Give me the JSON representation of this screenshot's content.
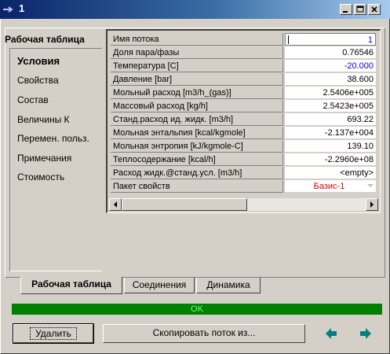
{
  "window": {
    "title": "1",
    "system_icon": "stream-icon",
    "controls": [
      "minimize-icon",
      "maximize-icon",
      "close-icon"
    ]
  },
  "nav": {
    "title": "Рабочая таблица",
    "items": [
      {
        "label": "Условия",
        "active": true
      },
      {
        "label": "Свойства",
        "active": false
      },
      {
        "label": "Состав",
        "active": false
      },
      {
        "label": "Величины К",
        "active": false
      },
      {
        "label": "Перемен. польз.",
        "active": false
      },
      {
        "label": "Примечания",
        "active": false
      },
      {
        "label": "Стоимость",
        "active": false
      }
    ]
  },
  "grid": {
    "rows": [
      {
        "label": "Имя потока",
        "value": "1",
        "style": "blue"
      },
      {
        "label": "Доля пара/фазы",
        "value": "0.76546",
        "style": "black"
      },
      {
        "label": "Температура [C]",
        "value": "-20.000",
        "style": "blue"
      },
      {
        "label": "Давление [bar]",
        "value": "38.600",
        "style": "black"
      },
      {
        "label": "Мольный расход [m3/h_(gas)]",
        "value": "2.5406e+005",
        "style": "black"
      },
      {
        "label": "Массовый расход [kg/h]",
        "value": "2.5423e+005",
        "style": "black"
      },
      {
        "label": "Станд.расход ид. жидк. [m3/h]",
        "value": "693.22",
        "style": "black"
      },
      {
        "label": "Мольная энтальпия [kcal/kgmole]",
        "value": "-2.137e+004",
        "style": "black"
      },
      {
        "label": "Мольная энтропия [kJ/kgmole-C]",
        "value": "139.10",
        "style": "black"
      },
      {
        "label": "Теплосодержание [kcal/h]",
        "value": "-2.2960e+08",
        "style": "black"
      },
      {
        "label": "Расход жидк.@станд.усл. [m3/h]",
        "value": "<empty>",
        "style": "black"
      },
      {
        "label": "Пакет свойств",
        "value": "Базис-1",
        "style": "red"
      }
    ]
  },
  "tabs": [
    {
      "label": "Рабочая таблица",
      "active": true
    },
    {
      "label": "Соединения",
      "active": false
    },
    {
      "label": "Динамика",
      "active": false
    }
  ],
  "status": {
    "text": "OK",
    "color": "#008000"
  },
  "buttons": {
    "delete": "Удалить",
    "copy_stream": "Скопировать поток из...",
    "prev_icon": "arrow-left-icon",
    "next_icon": "arrow-right-icon"
  },
  "colors": {
    "value_blue": "#0000ff",
    "value_red": "#e00000",
    "arrow_green": "#008080"
  }
}
